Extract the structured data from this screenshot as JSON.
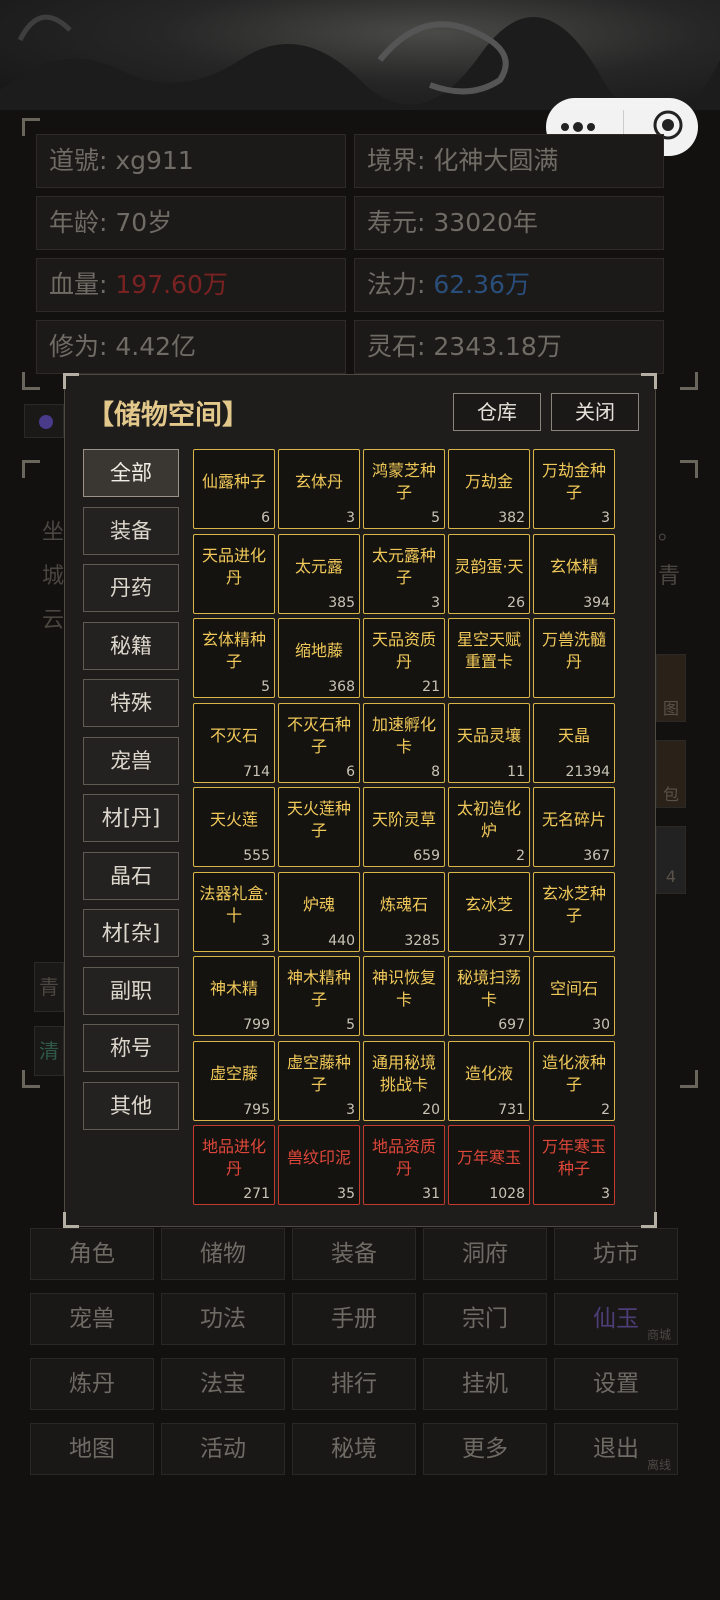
{
  "profile": {
    "dao_label": "道號",
    "dao_value": "xg911",
    "realm_label": "境界",
    "realm_value": "化神大圆满",
    "age_label": "年龄",
    "age_value": "70岁",
    "life_label": "寿元",
    "life_value": "33020年",
    "hp_label": "血量",
    "hp_value": "197.60万",
    "mp_label": "法力",
    "mp_value": "62.36万",
    "cultivation_label": "修为",
    "cultivation_value": "4.42亿",
    "stone_label": "灵石",
    "stone_value": "2343.18万"
  },
  "background_text": {
    "line1_left": "坐",
    "line2_left": "城",
    "line3_left": "云",
    "line1_right": "。",
    "line2_right": "青",
    "side_a": "青",
    "side_b": "清",
    "thumb1": "图",
    "thumb2": "包",
    "thumb3": "4"
  },
  "modal": {
    "title": "【储物空间】",
    "warehouse_label": "仓库",
    "close_label": "关闭",
    "categories": [
      "全部",
      "装备",
      "丹药",
      "秘籍",
      "特殊",
      "宠兽",
      "材[丹]",
      "晶石",
      "材[杂]",
      "副职",
      "称号",
      "其他"
    ],
    "items": [
      {
        "name": "仙露种子",
        "count": "6"
      },
      {
        "name": "玄体丹",
        "count": "3"
      },
      {
        "name": "鸿蒙芝种子",
        "count": "5"
      },
      {
        "name": "万劫金",
        "count": "382"
      },
      {
        "name": "万劫金种子",
        "count": "3"
      },
      {
        "name": "天品进化丹",
        "count": ""
      },
      {
        "name": "太元露",
        "count": "385"
      },
      {
        "name": "太元露种子",
        "count": "3"
      },
      {
        "name": "灵韵蛋·天",
        "count": "26"
      },
      {
        "name": "玄体精",
        "count": "394"
      },
      {
        "name": "玄体精种子",
        "count": "5"
      },
      {
        "name": "缩地藤",
        "count": "368"
      },
      {
        "name": "天品资质丹",
        "count": "21"
      },
      {
        "name": "星空天赋重置卡",
        "count": ""
      },
      {
        "name": "万兽洗髓丹",
        "count": ""
      },
      {
        "name": "不灭石",
        "count": "714"
      },
      {
        "name": "不灭石种子",
        "count": "6"
      },
      {
        "name": "加速孵化卡",
        "count": "8"
      },
      {
        "name": "天品灵壤",
        "count": "11"
      },
      {
        "name": "天晶",
        "count": "21394"
      },
      {
        "name": "天火莲",
        "count": "555"
      },
      {
        "name": "天火莲种子",
        "count": ""
      },
      {
        "name": "天阶灵草",
        "count": "659"
      },
      {
        "name": "太初造化炉",
        "count": "2"
      },
      {
        "name": "无名碎片",
        "count": "367"
      },
      {
        "name": "法器礼盒·十",
        "count": "3"
      },
      {
        "name": "炉魂",
        "count": "440"
      },
      {
        "name": "炼魂石",
        "count": "3285"
      },
      {
        "name": "玄冰芝",
        "count": "377"
      },
      {
        "name": "玄冰芝种子",
        "count": ""
      },
      {
        "name": "神木精",
        "count": "799"
      },
      {
        "name": "神木精种子",
        "count": "5"
      },
      {
        "name": "神识恢复卡",
        "count": ""
      },
      {
        "name": "秘境扫荡卡",
        "count": "697"
      },
      {
        "name": "空间石",
        "count": "30"
      },
      {
        "name": "虚空藤",
        "count": "795"
      },
      {
        "name": "虚空藤种子",
        "count": "3"
      },
      {
        "name": "通用秘境挑战卡",
        "count": "20"
      },
      {
        "name": "造化液",
        "count": "731"
      },
      {
        "name": "造化液种子",
        "count": "2"
      },
      {
        "name": "地品进化丹",
        "count": "271",
        "red": true
      },
      {
        "name": "兽纹印泥",
        "count": "35",
        "red": true
      },
      {
        "name": "地品资质丹",
        "count": "31",
        "red": true
      },
      {
        "name": "万年寒玉",
        "count": "1028",
        "red": true
      },
      {
        "name": "万年寒玉种子",
        "count": "3",
        "red": true
      }
    ]
  },
  "menu": [
    {
      "label": "角色"
    },
    {
      "label": "储物"
    },
    {
      "label": "装备"
    },
    {
      "label": "洞府"
    },
    {
      "label": "坊市"
    },
    {
      "label": "宠兽"
    },
    {
      "label": "功法"
    },
    {
      "label": "手册"
    },
    {
      "label": "宗门"
    },
    {
      "label": "仙玉",
      "sub": "商城",
      "purple": true
    },
    {
      "label": "炼丹"
    },
    {
      "label": "法宝"
    },
    {
      "label": "排行"
    },
    {
      "label": "挂机"
    },
    {
      "label": "设置"
    },
    {
      "label": "地图"
    },
    {
      "label": "活动"
    },
    {
      "label": "秘境"
    },
    {
      "label": "更多"
    },
    {
      "label": "退出",
      "sub": "离线"
    }
  ],
  "colors": {
    "item_border": "#d9b446",
    "item_border_red": "#c43a2e",
    "title": "#e3c88c"
  }
}
